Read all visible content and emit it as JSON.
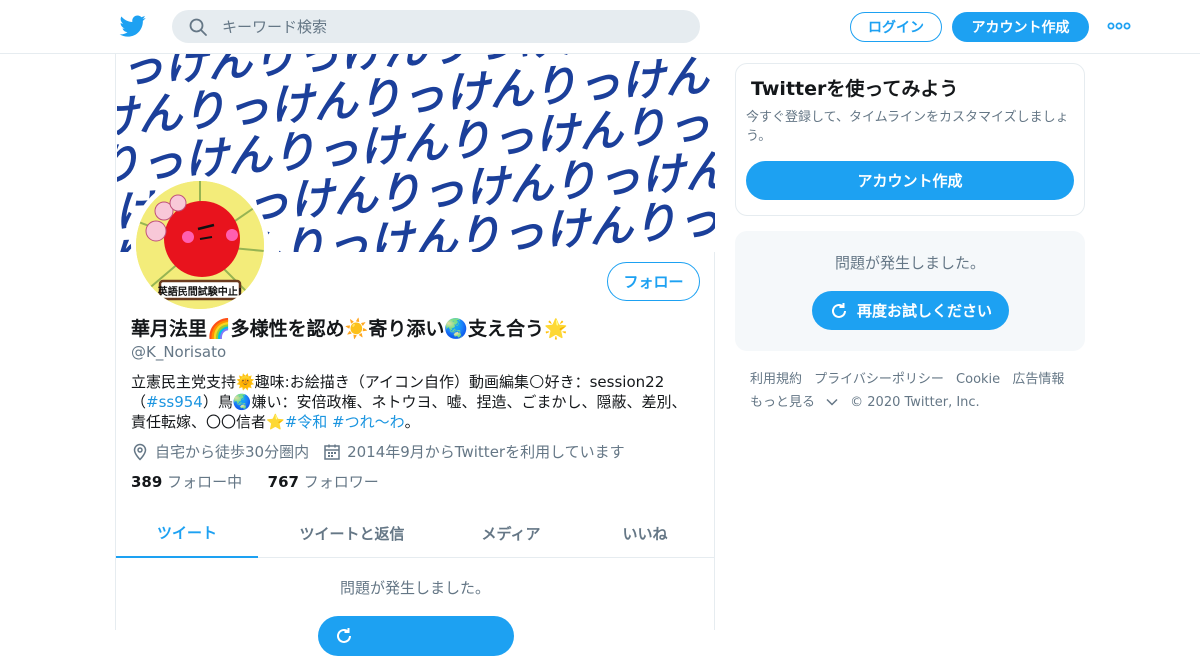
{
  "nav": {
    "search_placeholder": "キーワード検索",
    "login_label": "ログイン",
    "signup_label": "アカウント作成",
    "more_icon": "more-horizontal-icon"
  },
  "profile": {
    "banner_text": "りっけんりっけんりっけんりっけんりっけん",
    "avatar_badge": "英語民間試験中止!",
    "follow_label": "フォロー",
    "display_name": "華月法里🌈多様性を認め☀️寄り添い🌏支え合う🌟",
    "screen_name": "@K_Norisato",
    "bio": {
      "part1": "立憲民主党支持🌞趣味:お絵描き（アイコン自作）動画編集🌕好き：session22（",
      "tag1": "#ss954",
      "part2": "）鳥🌏嫌い：安倍政権、ネトウヨ、嘘、捏造、ごまかし、隠蔽、差別、責任転嫁、〇〇信者⭐",
      "tag2": "#令和",
      "tag3": "#つれ〜わ",
      "part3": "。"
    },
    "location": "自宅から徒歩30分圏内",
    "joined": "2014年9月からTwitterを利用しています",
    "following_count": "389",
    "following_label": "フォロー中",
    "followers_count": "767",
    "followers_label": "フォロワー"
  },
  "tabs": [
    {
      "label": "ツイート",
      "active": true
    },
    {
      "label": "ツイートと返信",
      "active": false
    },
    {
      "label": "メディア",
      "active": false
    },
    {
      "label": "いいね",
      "active": false
    }
  ],
  "main_error": {
    "message": "問題が発生しました。"
  },
  "sidebar": {
    "signup_card": {
      "title": "Twitterを使ってみよう",
      "description": "今すぐ登録して、タイムラインをカスタマイズしましょう。",
      "button": "アカウント作成"
    },
    "error_card": {
      "message": "問題が発生しました。",
      "retry_label": "再度お試しください"
    },
    "footer": {
      "links": [
        "利用規約",
        "プライバシーポリシー",
        "Cookie",
        "広告情報",
        "もっと見る"
      ],
      "copyright": "© 2020 Twitter, Inc."
    }
  },
  "colors": {
    "accent": "#1da1f2",
    "banner_blue": "#1b3f9a",
    "avatar_red": "#e8131d",
    "avatar_yellow": "#f3ec7a"
  }
}
